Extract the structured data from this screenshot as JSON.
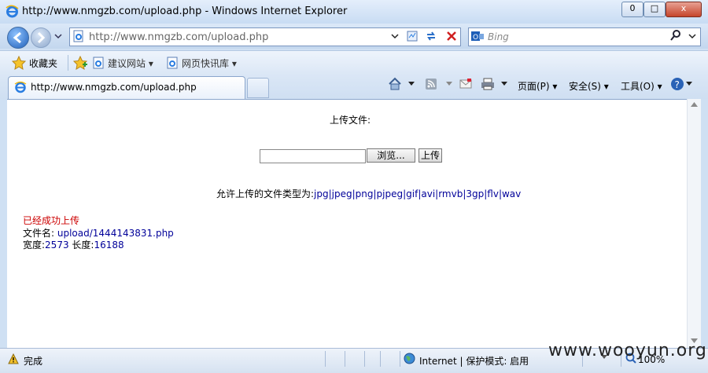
{
  "window": {
    "title": "http://www.nmgzb.com/upload.php - Windows Internet Explorer",
    "min": "0",
    "max": "□",
    "close": "x"
  },
  "nav": {
    "address": "http://www.nmgzb.com/upload.php",
    "search_placeholder": "Bing"
  },
  "favorites": {
    "label": "收藏夹",
    "items": [
      "建议网站 ▾",
      "网页快讯库 ▾"
    ]
  },
  "tabs": {
    "active": "http://www.nmgzb.com/upload.php"
  },
  "commands": {
    "page": "页面(P) ▾",
    "safety": "安全(S) ▾",
    "tools": "工具(O) ▾"
  },
  "page": {
    "heading": "上传文件:",
    "browse_label": "浏览...",
    "upload_label": "上传",
    "allowed_prefix": "允许上传的文件类型为:",
    "allowed_types": "jpg|jpeg|png|pjpeg|gif|avi|rmvb|3gp|flv|wav",
    "success": "已经成功上传",
    "filename_label": "文件名:",
    "filename_value": "upload/1444143831.php",
    "size_label_w": "宽度:",
    "size_w": "2573",
    "size_label_h": "长度:",
    "size_h": "16188"
  },
  "status": {
    "text": "完成",
    "zone": "Internet | 保护模式: 启用",
    "zoom": "100%"
  },
  "watermark": "www.wooyun.org",
  "colors": {
    "success_red": "#cc0000",
    "link_blue": "#000099"
  }
}
